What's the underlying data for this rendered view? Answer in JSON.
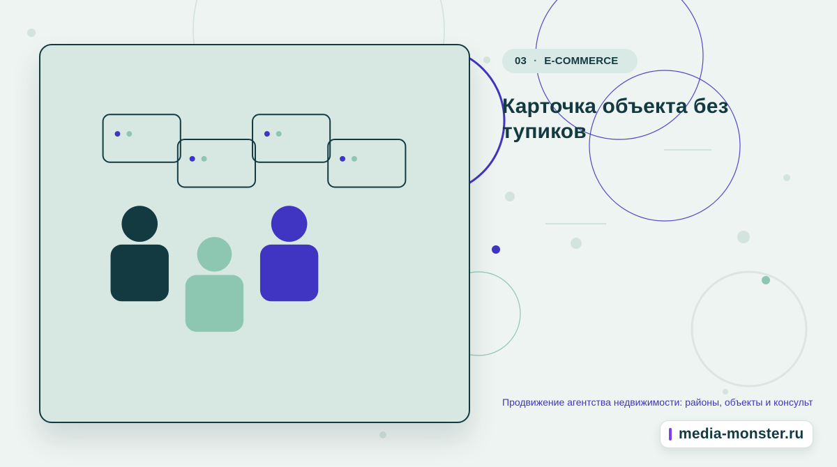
{
  "colors": {
    "background": "#eef4f1",
    "panel": "#d7e8e3",
    "ink": "#123a40",
    "purple": "#3f35c2",
    "mint": "#8ec7b1"
  },
  "header": {
    "index": "03",
    "separator": "·",
    "category": "E-COMMERCE"
  },
  "main": {
    "title": "Карточка объекта без тупиков",
    "subtitle": "Продвижение агентства недвижимости: районы, объекты и консульт"
  },
  "brand": {
    "name": "media-monster.ru"
  },
  "icons": {
    "illustration": "people-and-cards-illustration"
  }
}
